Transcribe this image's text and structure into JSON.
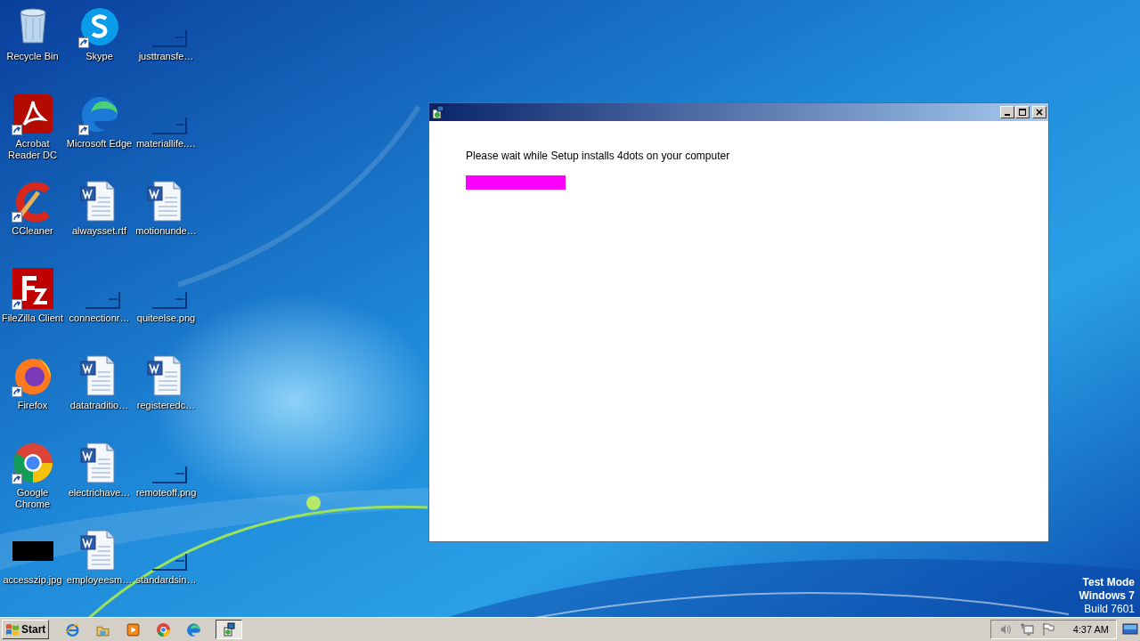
{
  "desktop": {
    "icons": [
      {
        "label": "Recycle Bin",
        "kind": "recycle",
        "shortcut": false
      },
      {
        "label": "Acrobat Reader DC",
        "kind": "pdf",
        "shortcut": true
      },
      {
        "label": "CCleaner",
        "kind": "ccleaner",
        "shortcut": true
      },
      {
        "label": "FileZilla Client",
        "kind": "filezilla",
        "shortcut": true
      },
      {
        "label": "Firefox",
        "kind": "firefox",
        "shortcut": true
      },
      {
        "label": "Google Chrome",
        "kind": "chrome",
        "shortcut": true
      },
      {
        "label": "accesszip.jpg",
        "kind": "dark-image",
        "shortcut": false
      },
      {
        "label": "Skype",
        "kind": "skype",
        "shortcut": true
      },
      {
        "label": "Microsoft Edge",
        "kind": "edge",
        "shortcut": true
      },
      {
        "label": "alwaysset.rtf",
        "kind": "word",
        "shortcut": false
      },
      {
        "label": "connectionr…",
        "kind": "blank",
        "shortcut": false
      },
      {
        "label": "datatraditio…",
        "kind": "word",
        "shortcut": false
      },
      {
        "label": "electrichave…",
        "kind": "word",
        "shortcut": false
      },
      {
        "label": "employeesm…",
        "kind": "word",
        "shortcut": false
      },
      {
        "label": "justtransfe…",
        "kind": "blank",
        "shortcut": false
      },
      {
        "label": "materiallife.…",
        "kind": "blank",
        "shortcut": false
      },
      {
        "label": "motionunde…",
        "kind": "word",
        "shortcut": false
      },
      {
        "label": "quiteelse.png",
        "kind": "blank",
        "shortcut": false
      },
      {
        "label": "registeredc…",
        "kind": "word",
        "shortcut": false
      },
      {
        "label": "remoteoff.png",
        "kind": "blank",
        "shortcut": false
      },
      {
        "label": "standardsin…",
        "kind": "blank",
        "shortcut": false
      }
    ],
    "watermark_lines": [
      {
        "text": "Test Mode",
        "bold": true
      },
      {
        "text": "Windows 7",
        "bold": true
      },
      {
        "text": "Build 7601",
        "bold": false
      }
    ]
  },
  "window": {
    "message": "Please wait while Setup installs 4dots on your computer"
  },
  "taskbar": {
    "start": "Start",
    "tasks": [
      {
        "selected": true
      }
    ],
    "clock": "4:37 AM"
  }
}
